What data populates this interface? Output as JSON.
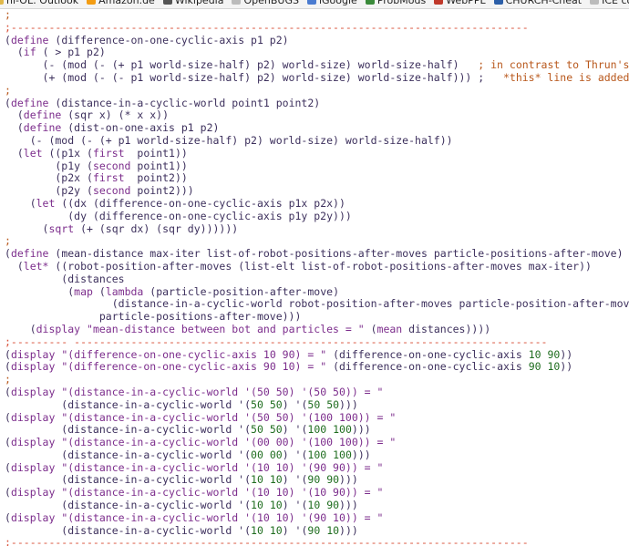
{
  "bookmarks_bar": {
    "items": [
      {
        "label": "hi-OL: Outlook",
        "icon": "folder-icon",
        "color": "#e0b84a"
      },
      {
        "label": "Amazon.de",
        "icon": "amazon-icon",
        "color": "#f39c12"
      },
      {
        "label": "Wikipedia",
        "icon": "wikipedia-icon",
        "color": "#555555"
      },
      {
        "label": "OpenBUGS",
        "icon": "page-icon",
        "color": "#bbbbbb"
      },
      {
        "label": "iGoogle",
        "icon": "google-icon",
        "color": "#4a7bd0"
      },
      {
        "label": "ProbMods",
        "icon": "probmods-icon",
        "color": "#3a8a3a"
      },
      {
        "label": "WebPPL",
        "icon": "webppl-icon",
        "color": "#c0392b"
      },
      {
        "label": "CHURCH-Cheat",
        "icon": "church-icon",
        "color": "#2c5fa8"
      },
      {
        "label": "ICE code editor",
        "icon": "page-icon",
        "color": "#bbbbbb"
      }
    ]
  },
  "editor": {
    "colors": {
      "text": "#3c2f5c",
      "keyword": "#7c2d8c",
      "string": "#7c2d8c",
      "number": "#1f6d1f",
      "comment": "#b8571b",
      "separator": "#d9523a"
    },
    "lines": [
      [
        [
          "com",
          ";"
        ]
      ],
      [
        [
          "sep",
          ";----------------------------------------------------------------------------------"
        ]
      ],
      [
        [
          "pl",
          "("
        ],
        [
          "kw",
          "define"
        ],
        [
          "pl",
          " (difference-on-one-cyclic-axis p1 p2)"
        ]
      ],
      [
        [
          "pl",
          "  ("
        ],
        [
          "kw",
          "if"
        ],
        [
          "pl",
          " ( > p1 p2)"
        ]
      ],
      [
        [
          "pl",
          "      (- (mod (- (+ p1 world-size-half) p2) world-size) world-size-half)   "
        ],
        [
          "com",
          "; in contrast to Thrun's code"
        ]
      ],
      [
        [
          "pl",
          "      (+ (mod (- (- p1 world-size-half) p2) world-size) world-size-half))) ; "
        ],
        [
          "com",
          "  *this* line is added"
        ]
      ],
      [
        [
          "com",
          ";"
        ]
      ],
      [
        [
          "pl",
          "("
        ],
        [
          "kw",
          "define"
        ],
        [
          "pl",
          " (distance-in-a-cyclic-world point1 point2)"
        ]
      ],
      [
        [
          "pl",
          "  ("
        ],
        [
          "kw",
          "define"
        ],
        [
          "pl",
          " (sqr x) (* x x))"
        ]
      ],
      [
        [
          "pl",
          "  ("
        ],
        [
          "kw",
          "define"
        ],
        [
          "pl",
          " (dist-on-one-axis p1 p2)"
        ]
      ],
      [
        [
          "pl",
          "    (- (mod (- (+ p1 world-size-half) p2) world-size) world-size-half))"
        ]
      ],
      [
        [
          "pl",
          "  ("
        ],
        [
          "kw",
          "let"
        ],
        [
          "pl",
          " ((p1x ("
        ],
        [
          "kw",
          "first"
        ],
        [
          "pl",
          "  point1))"
        ]
      ],
      [
        [
          "pl",
          "        (p1y ("
        ],
        [
          "kw",
          "second"
        ],
        [
          "pl",
          " point1))"
        ]
      ],
      [
        [
          "pl",
          "        (p2x ("
        ],
        [
          "kw",
          "first"
        ],
        [
          "pl",
          "  point2))"
        ]
      ],
      [
        [
          "pl",
          "        (p2y ("
        ],
        [
          "kw",
          "second"
        ],
        [
          "pl",
          " point2)))"
        ]
      ],
      [
        [
          "pl",
          "    ("
        ],
        [
          "kw",
          "let"
        ],
        [
          "pl",
          " ((dx (difference-on-one-cyclic-axis p1x p2x))"
        ]
      ],
      [
        [
          "pl",
          "          (dy (difference-on-one-cyclic-axis p1y p2y)))"
        ]
      ],
      [
        [
          "pl",
          "      ("
        ],
        [
          "kw",
          "sqrt"
        ],
        [
          "pl",
          " (+ (sqr dx) (sqr dy))))))"
        ]
      ],
      [
        [
          "com",
          ";"
        ]
      ],
      [
        [
          "pl",
          "("
        ],
        [
          "kw",
          "define"
        ],
        [
          "pl",
          " (mean-distance max-iter list-of-robot-positions-after-moves particle-positions-after-move)"
        ]
      ],
      [
        [
          "pl",
          "  ("
        ],
        [
          "kw",
          "let*"
        ],
        [
          "pl",
          " ((robot-position-after-moves (list-elt list-of-robot-positions-after-moves max-iter))"
        ]
      ],
      [
        [
          "pl",
          "         (distances"
        ]
      ],
      [
        [
          "pl",
          "          ("
        ],
        [
          "kw",
          "map"
        ],
        [
          "pl",
          " ("
        ],
        [
          "kw",
          "lambda"
        ],
        [
          "pl",
          " (particle-position-after-move)"
        ]
      ],
      [
        [
          "pl",
          "                 (distance-in-a-cyclic-world robot-position-after-moves particle-position-after-move))"
        ]
      ],
      [
        [
          "pl",
          "               particle-positions-after-move)))"
        ]
      ],
      [
        [
          "pl",
          "    ("
        ],
        [
          "kw",
          "display"
        ],
        [
          "pl",
          " "
        ],
        [
          "str",
          "\"mean-distance between bot and particles = \""
        ],
        [
          "pl",
          " ("
        ],
        [
          "kw",
          "mean"
        ],
        [
          "pl",
          " distances))))"
        ]
      ],
      [
        [
          "sep",
          ";--------- ---------------------------------------------------------------------------"
        ]
      ],
      [
        [
          "pl",
          "("
        ],
        [
          "kw",
          "display"
        ],
        [
          "pl",
          " "
        ],
        [
          "str",
          "\"(difference-on-one-cyclic-axis 10 90) = \""
        ],
        [
          "pl",
          " (difference-on-one-cyclic-axis "
        ],
        [
          "num",
          "10"
        ],
        [
          "pl",
          " "
        ],
        [
          "num",
          "90"
        ],
        [
          "pl",
          "))"
        ]
      ],
      [
        [
          "pl",
          "("
        ],
        [
          "kw",
          "display"
        ],
        [
          "pl",
          " "
        ],
        [
          "str",
          "\"(difference-on-one-cyclic-axis 90 10) = \""
        ],
        [
          "pl",
          " (difference-on-one-cyclic-axis "
        ],
        [
          "num",
          "90"
        ],
        [
          "pl",
          " "
        ],
        [
          "num",
          "10"
        ],
        [
          "pl",
          "))"
        ]
      ],
      [
        [
          "com",
          ";"
        ]
      ],
      [
        [
          "pl",
          "("
        ],
        [
          "kw",
          "display"
        ],
        [
          "pl",
          " "
        ],
        [
          "str",
          "\"(distance-in-a-cyclic-world '(50 50) '(50 50)) = \""
        ]
      ],
      [
        [
          "pl",
          "         (distance-in-a-cyclic-world '("
        ],
        [
          "num",
          "50"
        ],
        [
          "pl",
          " "
        ],
        [
          "num",
          "50"
        ],
        [
          "pl",
          ") '("
        ],
        [
          "num",
          "50"
        ],
        [
          "pl",
          " "
        ],
        [
          "num",
          "50"
        ],
        [
          "pl",
          ")))"
        ]
      ],
      [
        [
          "pl",
          "("
        ],
        [
          "kw",
          "display"
        ],
        [
          "pl",
          " "
        ],
        [
          "str",
          "\"(distance-in-a-cyclic-world '(50 50) '(100 100)) = \""
        ]
      ],
      [
        [
          "pl",
          "         (distance-in-a-cyclic-world '("
        ],
        [
          "num",
          "50"
        ],
        [
          "pl",
          " "
        ],
        [
          "num",
          "50"
        ],
        [
          "pl",
          ") '("
        ],
        [
          "num",
          "100"
        ],
        [
          "pl",
          " "
        ],
        [
          "num",
          "100"
        ],
        [
          "pl",
          ")))"
        ]
      ],
      [
        [
          "pl",
          "("
        ],
        [
          "kw",
          "display"
        ],
        [
          "pl",
          " "
        ],
        [
          "str",
          "\"(distance-in-a-cyclic-world '(00 00) '(100 100)) = \""
        ]
      ],
      [
        [
          "pl",
          "         (distance-in-a-cyclic-world '("
        ],
        [
          "num",
          "00"
        ],
        [
          "pl",
          " "
        ],
        [
          "num",
          "00"
        ],
        [
          "pl",
          ") '("
        ],
        [
          "num",
          "100"
        ],
        [
          "pl",
          " "
        ],
        [
          "num",
          "100"
        ],
        [
          "pl",
          ")))"
        ]
      ],
      [
        [
          "pl",
          "("
        ],
        [
          "kw",
          "display"
        ],
        [
          "pl",
          " "
        ],
        [
          "str",
          "\"(distance-in-a-cyclic-world '(10 10) '(90 90)) = \""
        ]
      ],
      [
        [
          "pl",
          "         (distance-in-a-cyclic-world '("
        ],
        [
          "num",
          "10"
        ],
        [
          "pl",
          " "
        ],
        [
          "num",
          "10"
        ],
        [
          "pl",
          ") '("
        ],
        [
          "num",
          "90"
        ],
        [
          "pl",
          " "
        ],
        [
          "num",
          "90"
        ],
        [
          "pl",
          ")))"
        ]
      ],
      [
        [
          "pl",
          "("
        ],
        [
          "kw",
          "display"
        ],
        [
          "pl",
          " "
        ],
        [
          "str",
          "\"(distance-in-a-cyclic-world '(10 10) '(10 90)) = \""
        ]
      ],
      [
        [
          "pl",
          "         (distance-in-a-cyclic-world '("
        ],
        [
          "num",
          "10"
        ],
        [
          "pl",
          " "
        ],
        [
          "num",
          "10"
        ],
        [
          "pl",
          ") '("
        ],
        [
          "num",
          "10"
        ],
        [
          "pl",
          " "
        ],
        [
          "num",
          "90"
        ],
        [
          "pl",
          ")))"
        ]
      ],
      [
        [
          "pl",
          "("
        ],
        [
          "kw",
          "display"
        ],
        [
          "pl",
          " "
        ],
        [
          "str",
          "\"(distance-in-a-cyclic-world '(10 10) '(90 10)) = \""
        ]
      ],
      [
        [
          "pl",
          "         (distance-in-a-cyclic-world '("
        ],
        [
          "num",
          "10"
        ],
        [
          "pl",
          " "
        ],
        [
          "num",
          "10"
        ],
        [
          "pl",
          ") '("
        ],
        [
          "num",
          "90"
        ],
        [
          "pl",
          " "
        ],
        [
          "num",
          "10"
        ],
        [
          "pl",
          ")))"
        ]
      ],
      [
        [
          "sep",
          ";----------------------------------------------------------------------------------"
        ]
      ]
    ]
  }
}
